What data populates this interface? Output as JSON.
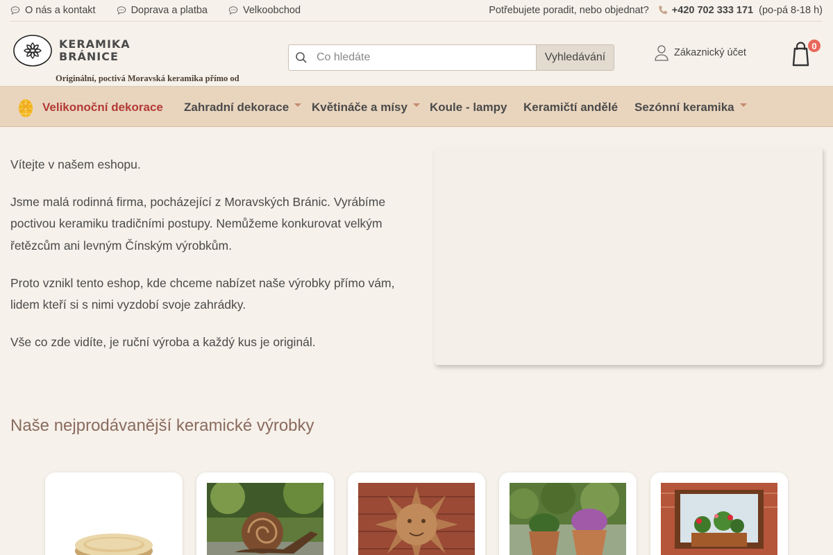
{
  "topbar": {
    "links": [
      {
        "label": "O nás a kontakt",
        "icon": "chat-bubble-icon"
      },
      {
        "label": "Doprava a platba",
        "icon": "chat-bubble-icon"
      },
      {
        "label": "Velkoobchod",
        "icon": "chat-bubble-icon"
      }
    ],
    "help_text": "Potřebujete poradit, nebo objednat?",
    "phone": "+420 702 333 171",
    "hours": "(po-pá 8-18 h)"
  },
  "header": {
    "logo_line1": "KERAMIKA",
    "logo_line2": "BRÁNICE",
    "tagline": "Originální, poctivá Moravská keramika přímo od výrobce.",
    "search_placeholder": "Co hledáte",
    "search_button": "Vyhledávání",
    "account_label": "Zákaznický účet",
    "cart_count": "0"
  },
  "nav": {
    "items": [
      {
        "label": "Velikonoční dekorace",
        "icon": "easter-egg-icon",
        "dropdown": false
      },
      {
        "label": "Zahradní dekorace",
        "dropdown": true
      },
      {
        "label": "Květináče a mísy",
        "dropdown": true
      },
      {
        "label": "Koule - lampy",
        "dropdown": false
      },
      {
        "label": "Keramičtí andělé",
        "dropdown": false
      },
      {
        "label": "Sezónní keramika",
        "dropdown": true
      }
    ]
  },
  "intro": {
    "p1": "Vítejte v našem eshopu.",
    "p2": "Jsme malá rodinná firma, pocházející z Moravských Bránic. Vyrábíme poctivou keramiku tradičními postupy. Nemůžeme konkurovat velkým řetězcům ani levným Čínským výrobkům.",
    "p3": "Proto vznikl tento eshop, kde chceme nabízet naše výrobky přímo vám, lidem kteří si s nimi vyzdobí svoje zahrádky.",
    "p4": "Vše co zde vidíte, je ruční výroba a každý kus je originál."
  },
  "bestsellers": {
    "title": "Naše nejprodávanější keramické výrobky",
    "products": [
      {
        "image": "ceramic-saucer"
      },
      {
        "image": "ceramic-snail"
      },
      {
        "image": "ceramic-sun-face"
      },
      {
        "image": "herb-planters"
      },
      {
        "image": "window-flower-box"
      }
    ]
  },
  "colors": {
    "accent_red": "#b23a35",
    "nav_bg": "#e9d5be",
    "badge": "#e8685a",
    "section_title": "#8a6b5e"
  }
}
